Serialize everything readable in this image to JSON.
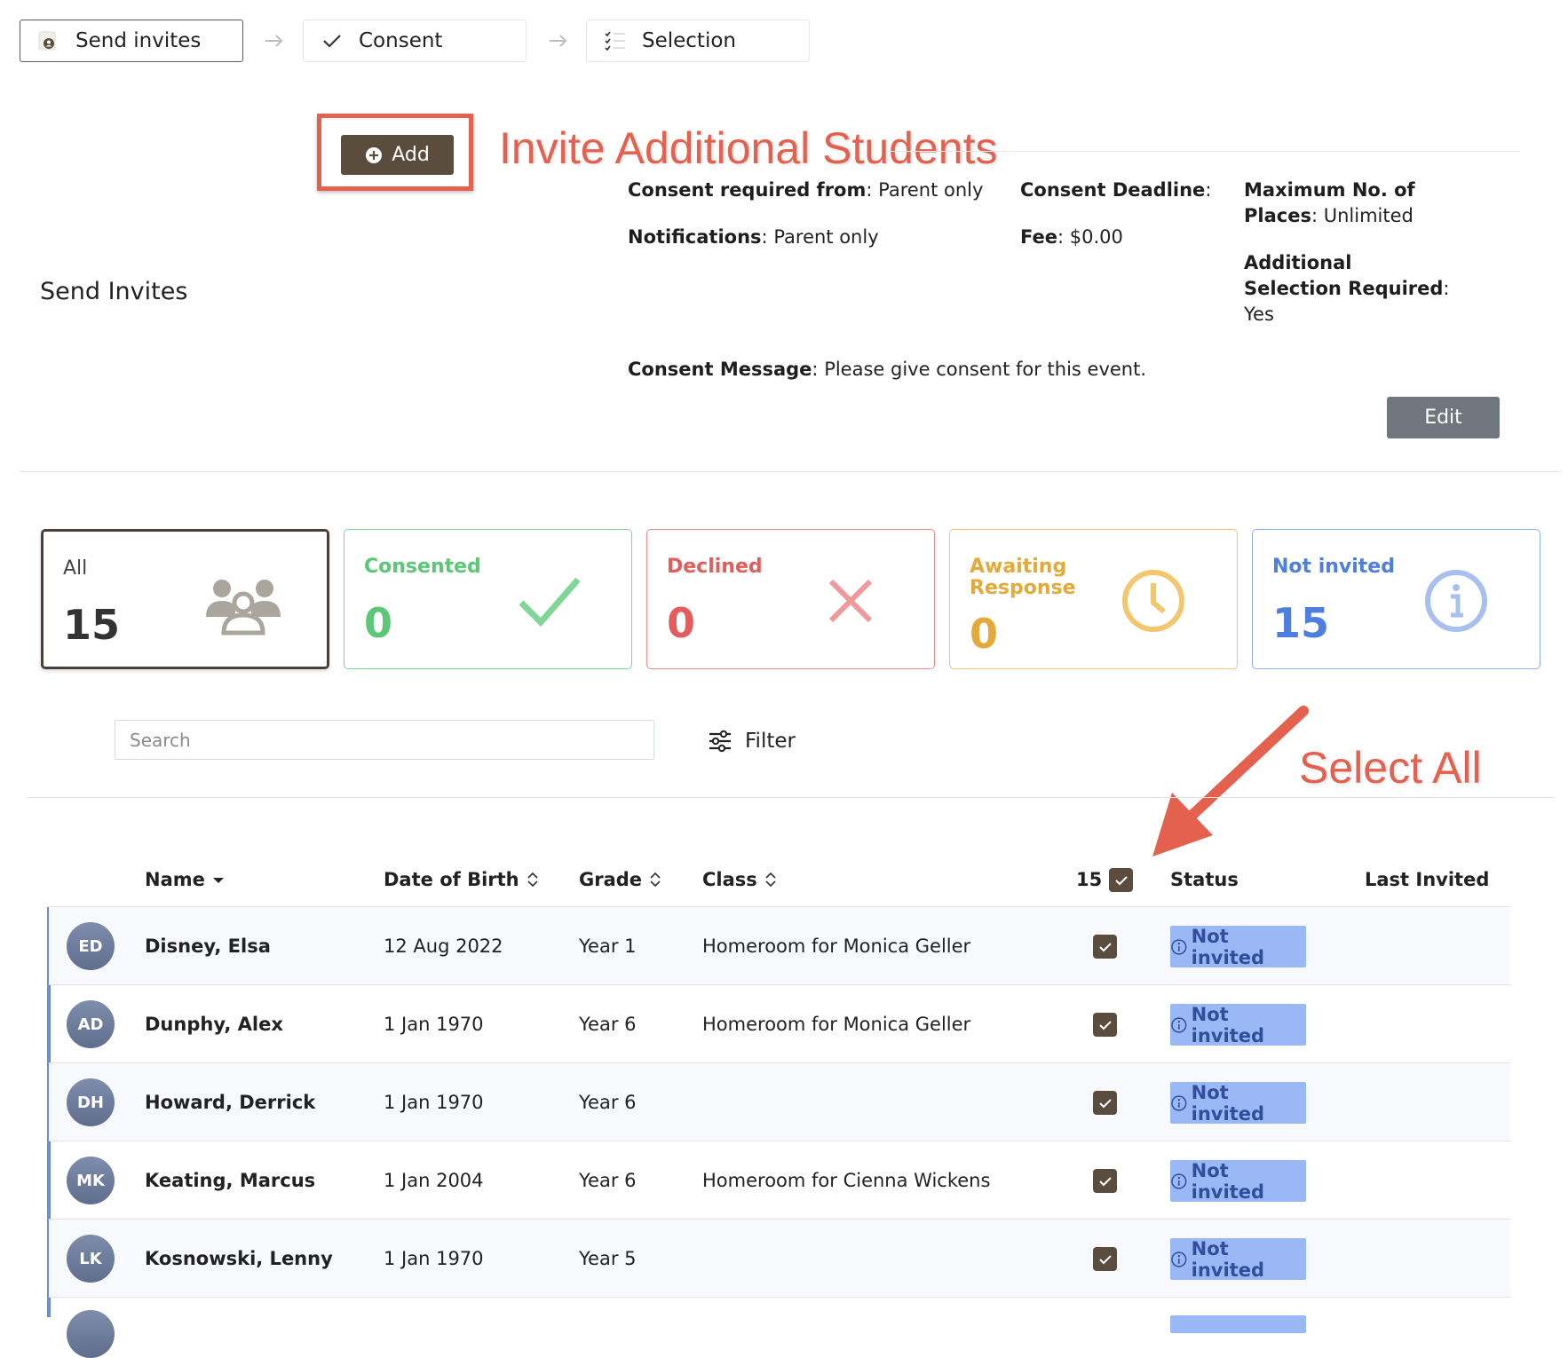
{
  "steps": [
    {
      "label": "Send invites",
      "icon": "send-invites-icon",
      "active": true
    },
    {
      "label": "Consent",
      "icon": "check-icon",
      "active": false
    },
    {
      "label": "Selection",
      "icon": "checklist-icon",
      "active": false
    }
  ],
  "add_button": {
    "label": "Add"
  },
  "annotations": {
    "invite": "Invite Additional Students",
    "select_all": "Select All",
    "color": "#e4604f"
  },
  "section": {
    "title": "Send Invites"
  },
  "info": {
    "consent_required": {
      "label": "Consent required from",
      "value": "Parent only"
    },
    "notifications": {
      "label": "Notifications",
      "value": "Parent only"
    },
    "deadline": {
      "label": "Consent Deadline",
      "value": ""
    },
    "fee": {
      "label": "Fee",
      "value": "$0.00"
    },
    "max_places": {
      "label_line1": "Maximum No. of",
      "label_line2": "Places",
      "value": "Unlimited"
    },
    "additional": {
      "label_line1": "Additional",
      "label_line2": "Selection Required",
      "value": "Yes"
    },
    "message": {
      "label": "Consent Message",
      "value": "Please give consent for this event."
    }
  },
  "edit_button": {
    "label": "Edit"
  },
  "stats": [
    {
      "label": "All",
      "count": "15",
      "color": "#3b3b3b",
      "icon": "users-icon"
    },
    {
      "label": "Consented",
      "count": "0",
      "color": "#5cc679",
      "icon": "check-icon"
    },
    {
      "label": "Declined",
      "count": "0",
      "color": "#e35d5d",
      "icon": "x-icon"
    },
    {
      "label": "Awaiting Response",
      "label_line1": "Awaiting",
      "label_line2": "Response",
      "count": "0",
      "color": "#e5a93a",
      "icon": "clock-icon"
    },
    {
      "label": "Not invited",
      "count": "15",
      "color": "#4d7ee0",
      "icon": "info-icon"
    }
  ],
  "search": {
    "placeholder": "Search"
  },
  "filter": {
    "label": "Filter"
  },
  "table": {
    "headers": {
      "name": "Name",
      "dob": "Date of Birth",
      "grade": "Grade",
      "class": "Class",
      "select_count": "15",
      "status": "Status",
      "last_invited": "Last Invited"
    },
    "rows": [
      {
        "initials": "ED",
        "name": "Disney, Elsa",
        "dob": "12 Aug 2022",
        "grade": "Year 1",
        "class": "Homeroom for Monica Geller",
        "status": "Not invited",
        "last_invited": ""
      },
      {
        "initials": "AD",
        "name": "Dunphy, Alex",
        "dob": "1 Jan 1970",
        "grade": "Year 6",
        "class": "Homeroom for Monica Geller",
        "status": "Not invited",
        "last_invited": ""
      },
      {
        "initials": "DH",
        "name": "Howard, Derrick",
        "dob": "1 Jan 1970",
        "grade": "Year 6",
        "class": "",
        "status": "Not invited",
        "last_invited": ""
      },
      {
        "initials": "MK",
        "name": "Keating, Marcus",
        "dob": "1 Jan 2004",
        "grade": "Year 6",
        "class": "Homeroom for Cienna Wickens",
        "status": "Not invited",
        "last_invited": ""
      },
      {
        "initials": "LK",
        "name": "Kosnowski, Lenny",
        "dob": "1 Jan 1970",
        "grade": "Year 5",
        "class": "",
        "status": "Not invited",
        "last_invited": ""
      }
    ]
  }
}
